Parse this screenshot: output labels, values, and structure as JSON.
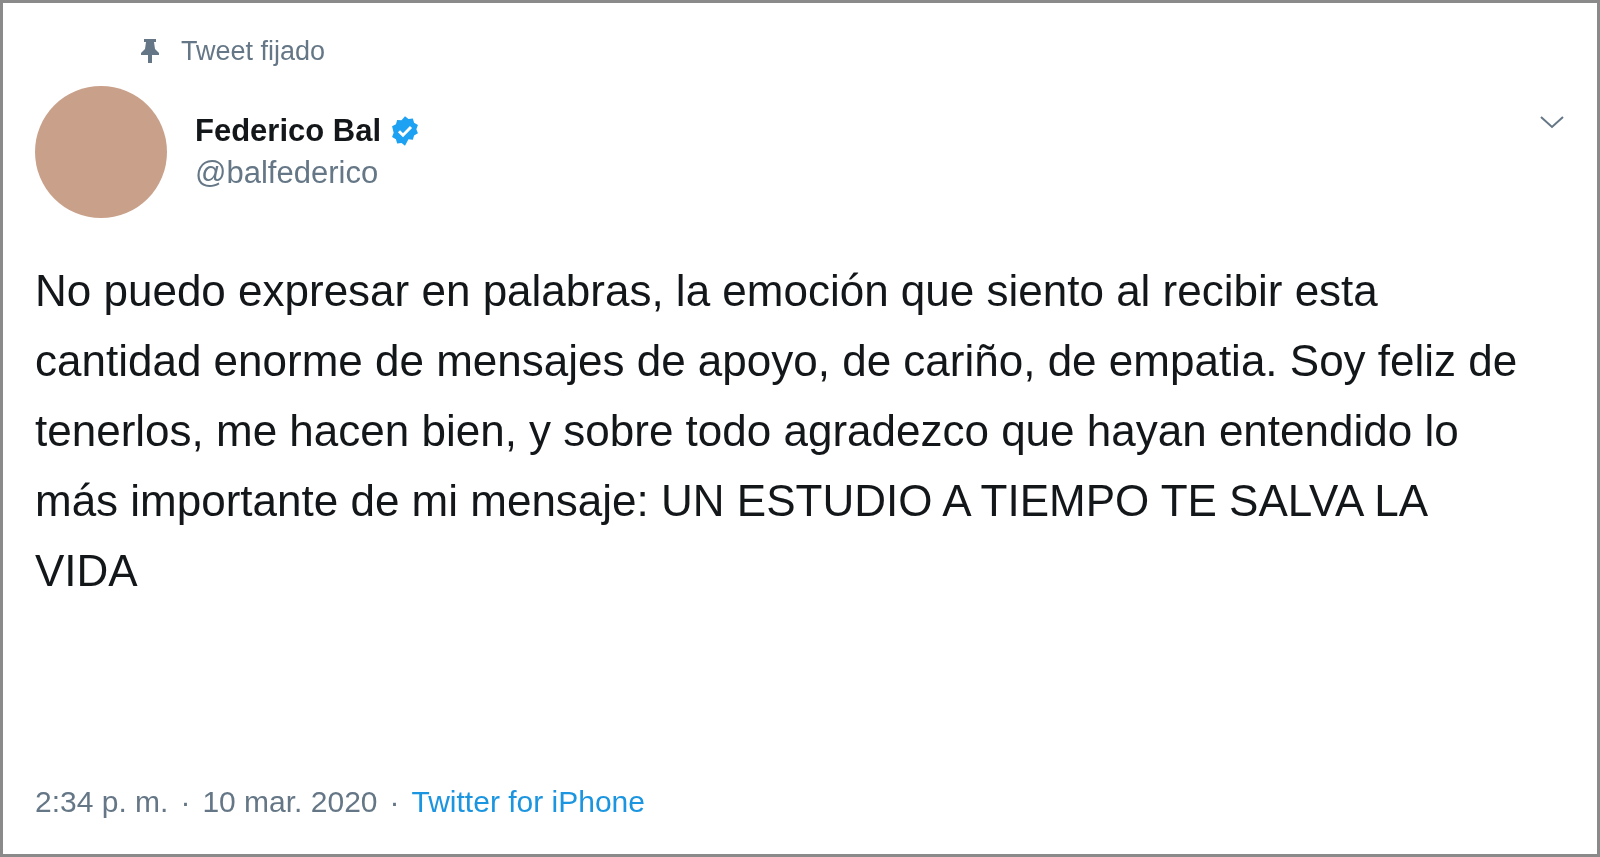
{
  "pinned_label": "Tweet fijado",
  "author": {
    "name": "Federico Bal",
    "handle": "@balfederico",
    "verified": true
  },
  "text": "No puedo expresar en palabras, la emoción que siento al recibir esta cantidad enorme de mensajes de apoyo, de cariño, de empatia. Soy feliz de tenerlos, me hacen bien, y sobre todo agradezco que hayan entendido lo más importante de mi mensaje: UN ESTUDIO A TIEMPO TE SALVA LA VIDA",
  "meta": {
    "time": "2:34 p. m.",
    "separator_1": "·",
    "date": "10 mar. 2020",
    "separator_2": "·",
    "source": "Twitter for iPhone"
  }
}
